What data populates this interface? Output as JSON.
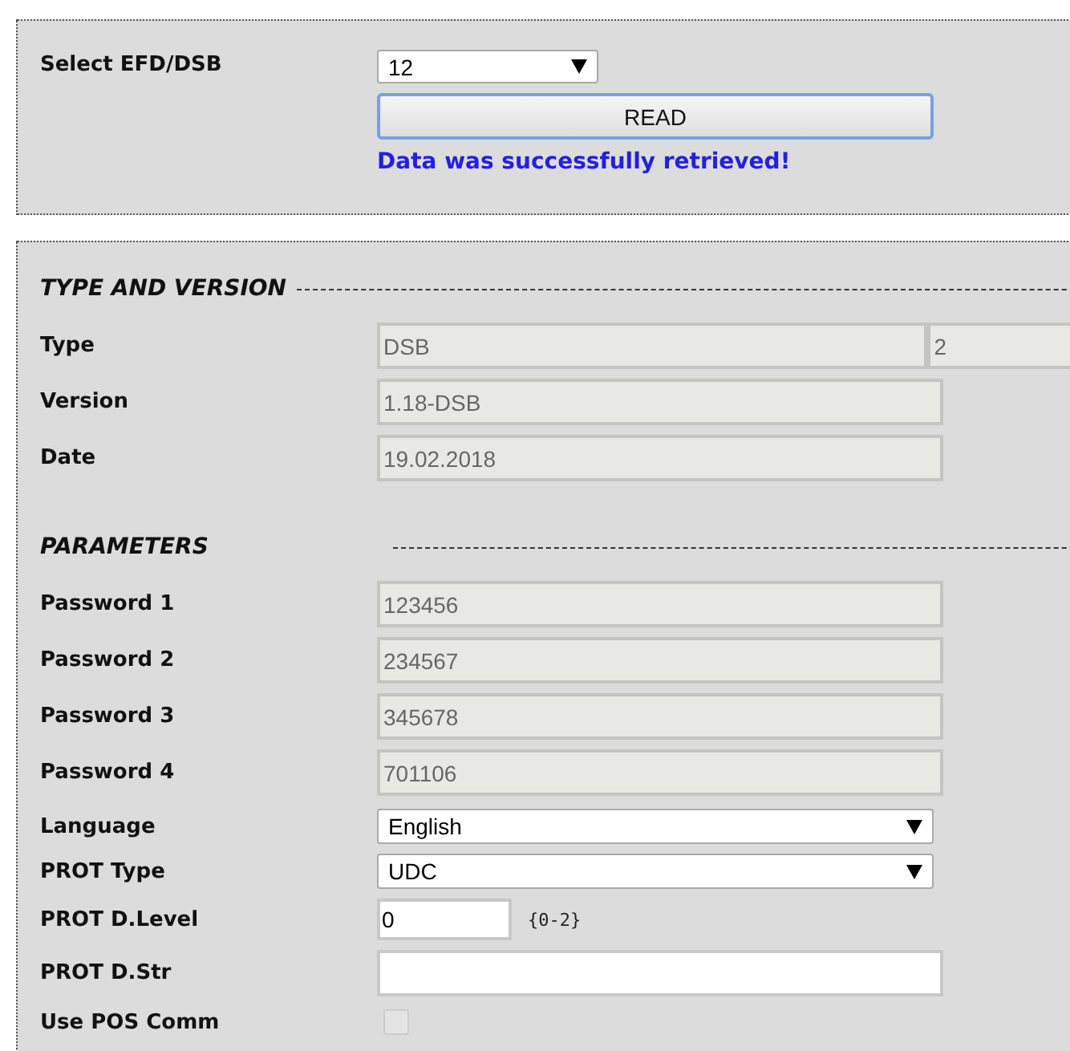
{
  "selector": {
    "label": "Select EFD/DSB",
    "value": "12",
    "button": "READ",
    "message": "Data was successfully retrieved!"
  },
  "sections": [
    {
      "title": "TYPE AND VERSION",
      "rows": [
        {
          "kind": "readonly",
          "label": "Type",
          "value": "DSB",
          "extra": "2"
        },
        {
          "kind": "readonly",
          "label": "Version",
          "value": "1.18-DSB"
        },
        {
          "kind": "readonly",
          "label": "Date",
          "value": "19.02.2018"
        }
      ]
    },
    {
      "title": "PARAMETERS",
      "rows": [
        {
          "kind": "readonly",
          "label": "Password 1",
          "value": "123456"
        },
        {
          "kind": "readonly",
          "label": "Password 2",
          "value": "234567"
        },
        {
          "kind": "readonly",
          "label": "Password 3",
          "value": "345678"
        },
        {
          "kind": "readonly",
          "label": "Password 4",
          "value": "701106"
        },
        {
          "kind": "select",
          "label": "Language",
          "value": "English"
        },
        {
          "kind": "select",
          "label": "PROT Type",
          "value": "UDC"
        },
        {
          "kind": "number",
          "label": "PROT D.Level",
          "value": "0",
          "hint": "{0-2}"
        },
        {
          "kind": "text",
          "label": "PROT D.Str"
        },
        {
          "kind": "checkbox",
          "label": "Use POS Comm",
          "checked": false,
          "disabled": true
        }
      ]
    }
  ]
}
